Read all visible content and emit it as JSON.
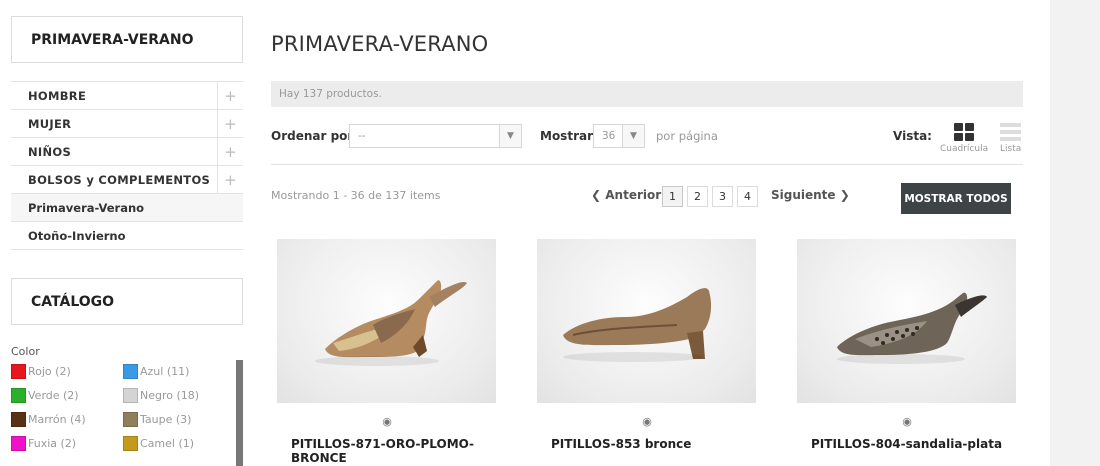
{
  "sidebar": {
    "section_title": "PRIMAVERA-VERANO",
    "categories": [
      {
        "label": "HOMBRE"
      },
      {
        "label": "MUJER"
      },
      {
        "label": "NIÑOS"
      },
      {
        "label": "BOLSOS y COMPLEMENTOS"
      },
      {
        "label": "Primavera-Verano"
      },
      {
        "label": "Otoño-Invierno"
      }
    ],
    "catalog_title": "CATÁLOGO",
    "color_filter": {
      "label": "Color",
      "options": [
        {
          "label": "Rojo (2)",
          "color": "#e8161e"
        },
        {
          "label": "Azul (11)",
          "color": "#3a9ae6"
        },
        {
          "label": "Verde (2)",
          "color": "#2bb02b"
        },
        {
          "label": "Negro (18)",
          "color": "#d4d4d4"
        },
        {
          "label": "Marrón (4)",
          "color": "#5a3014"
        },
        {
          "label": "Taupe (3)",
          "color": "#8f7f5b"
        },
        {
          "label": "Fuxia (2)",
          "color": "#f012c8"
        },
        {
          "label": "Camel (1)",
          "color": "#c49a1a"
        }
      ]
    }
  },
  "main": {
    "title": "PRIMAVERA-VERANO",
    "product_count": "Hay 137 productos.",
    "sort": {
      "label": "Ordenar por",
      "value": "--"
    },
    "show": {
      "label": "Mostrar",
      "value": "36",
      "suffix": "por página"
    },
    "view": {
      "label": "Vista:",
      "grid_label": "Cuadrícula",
      "list_label": "Lista"
    },
    "showing": "Mostrando 1 - 36 de 137 items",
    "pagination": {
      "prev": "Anterior",
      "pages": [
        "1",
        "2",
        "3",
        "4"
      ],
      "next": "Siguiente",
      "current": "1"
    },
    "show_all": "MOSTRAR TODOS",
    "products": [
      {
        "name": "PITILLOS-871-ORO-PLOMO-BRONCE"
      },
      {
        "name": "PITILLOS-853 bronce"
      },
      {
        "name": "PITILLOS-804-sandalia-plata"
      }
    ]
  }
}
